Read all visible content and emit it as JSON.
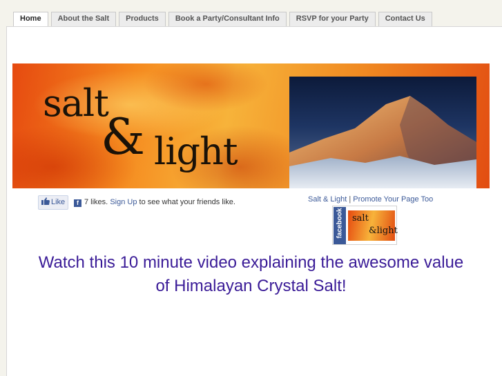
{
  "nav": {
    "tabs": [
      {
        "label": "Home",
        "active": true
      },
      {
        "label": "About the Salt",
        "active": false
      },
      {
        "label": "Products",
        "active": false
      },
      {
        "label": "Book a Party/Consultant Info",
        "active": false
      },
      {
        "label": "RSVP for your Party",
        "active": false
      },
      {
        "label": "Contact Us",
        "active": false
      }
    ]
  },
  "banner": {
    "logo_word1": "salt",
    "logo_amp": "&",
    "logo_word2": "light"
  },
  "like_bar": {
    "button_label": "Like",
    "fb_glyph": "f",
    "count_text": "7 likes.",
    "signup_link": "Sign Up",
    "suffix_text": "to see what your friends like."
  },
  "fb_badge": {
    "page_link": "Salt & Light",
    "separator": "|",
    "promote_link": "Promote Your Page Too",
    "brand": "facebook",
    "mini_word1": "salt",
    "mini_word2": "&light"
  },
  "headline": {
    "line1": "Watch this 10 minute video explaining the awesome value",
    "line2": "of Himalayan Crystal Salt!"
  },
  "colors": {
    "headline": "#3a1b97",
    "facebook_blue": "#3b5998",
    "page_bg": "#f4f3ec"
  }
}
